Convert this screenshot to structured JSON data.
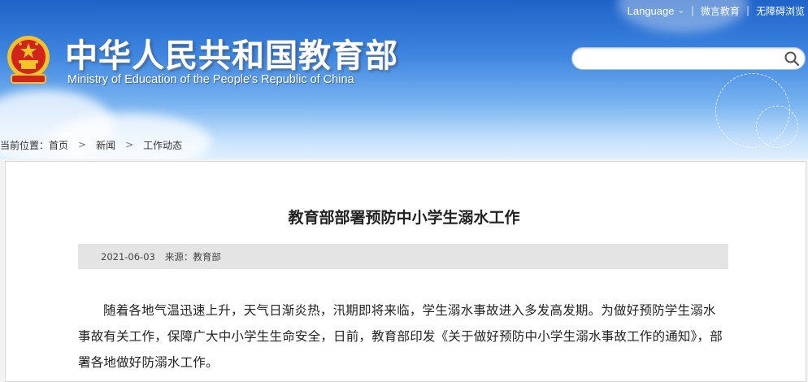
{
  "header": {
    "title_cn": "中华人民共和国教育部",
    "title_en": "Ministry of Education of the People's Republic of China",
    "links": {
      "language": "Language",
      "weibo": "微言教育",
      "accessible": "无障碍浏览"
    },
    "search": {
      "placeholder": ""
    }
  },
  "breadcrumb": {
    "prefix": "当前位置：",
    "items": [
      "首页",
      "新闻",
      "工作动态"
    ]
  },
  "article": {
    "title": "教育部部署预防中小学生溺水工作",
    "date": "2021-06-03",
    "source": "来源：教育部",
    "body": "随着各地气温迅速上升，天气日渐炎热，汛期即将来临，学生溺水事故进入多发高发期。为做好预防学生溺水事故有关工作，保障广大中小学生生命安全，日前，教育部印发《关于做好预防中小学生溺水事故工作的通知》，部署各地做好防溺水工作。"
  },
  "colors": {
    "banner_top": "#1f63c8",
    "banner_bottom": "#dfeffd",
    "emblem_red": "#d2231c",
    "emblem_gold": "#f3c42a",
    "meta_bar": "#e4e4e4"
  },
  "icons": [
    "national-emblem",
    "search-icon",
    "chevron-right-icon"
  ]
}
